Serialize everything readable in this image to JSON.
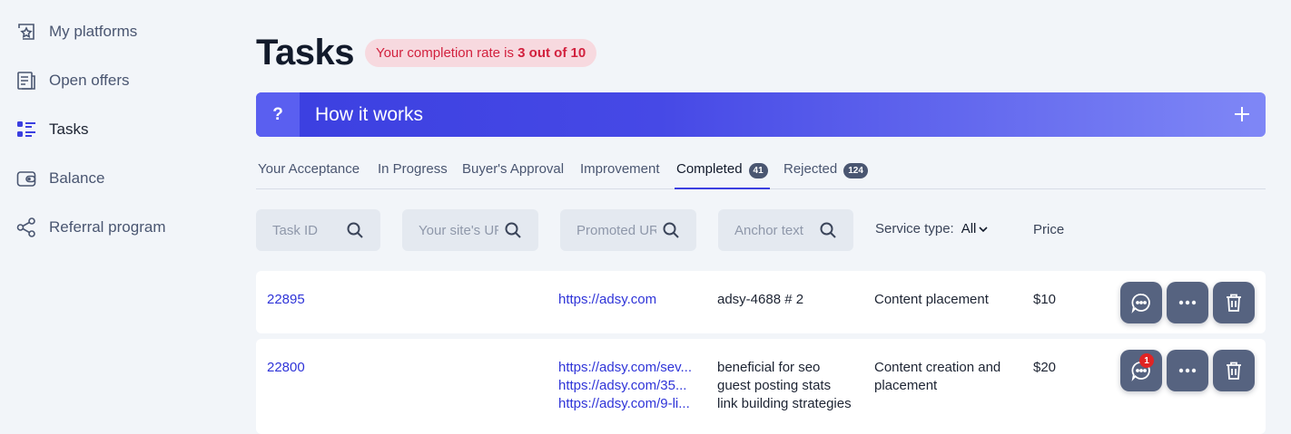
{
  "sidebar": {
    "items": [
      {
        "label": "My platforms",
        "icon": "star-frame-icon"
      },
      {
        "label": "Open offers",
        "icon": "document-icon"
      },
      {
        "label": "Tasks",
        "icon": "task-list-icon"
      },
      {
        "label": "Balance",
        "icon": "wallet-icon"
      },
      {
        "label": "Referral program",
        "icon": "share-nodes-icon"
      }
    ]
  },
  "header": {
    "title": "Tasks",
    "rate_prefix": "Your completion rate is",
    "rate_value": "3 out of 10"
  },
  "banner": {
    "icon": "?",
    "label": "How it works"
  },
  "tabs": [
    {
      "label": "Your Acceptance"
    },
    {
      "label": "In Progress"
    },
    {
      "label": "Buyer's Approval"
    },
    {
      "label": "Improvement"
    },
    {
      "label": "Completed",
      "count": "41"
    },
    {
      "label": "Rejected",
      "count": "124"
    }
  ],
  "filters": {
    "task_id_placeholder": "Task ID",
    "site_url_placeholder": "Your site's URL",
    "promoted_url_placeholder": "Promoted URL",
    "anchor_placeholder": "Anchor text",
    "service_type_label": "Service type:",
    "service_type_value": "All",
    "price_label": "Price"
  },
  "rows": [
    {
      "task_id": "22895",
      "promoted_urls": [
        "https://adsy.com"
      ],
      "anchors": [
        "adsy-4688 # 2"
      ],
      "service": "Content placement",
      "price": "$10",
      "messages": ""
    },
    {
      "task_id": "22800",
      "promoted_urls": [
        "https://adsy.com/sev...",
        "https://adsy.com/35...",
        "https://adsy.com/9-li..."
      ],
      "anchors": [
        "beneficial for seo",
        "guest posting stats",
        "link building strategies"
      ],
      "service": "Content creation and placement",
      "price": "$20",
      "messages": "1"
    }
  ],
  "colors": {
    "accent": "#3b3fe0",
    "link": "#2f34d8",
    "badge_bg": "#f7d9df",
    "badge_text": "#d2213e",
    "action_button": "#566380"
  }
}
